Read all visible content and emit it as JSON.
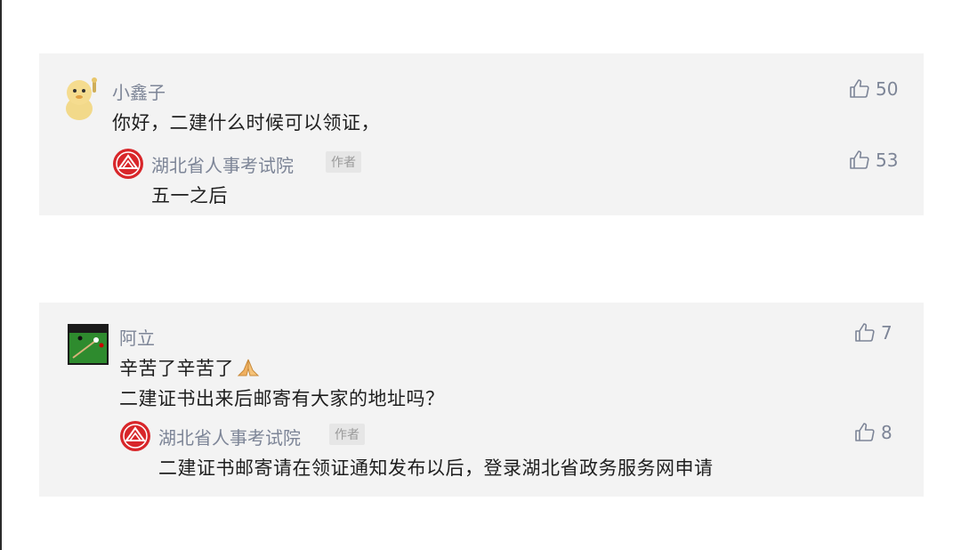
{
  "comments": [
    {
      "user": {
        "name": "小鑫子",
        "avatar": "yellow-chick-avatar"
      },
      "text_lines": [
        "你好，二建什么时候可以领证，"
      ],
      "likes": "50",
      "reply": {
        "user": {
          "name": "湖北省人事考试院",
          "avatar": "red-emblem-logo"
        },
        "badge": "作者",
        "text": "五一之后",
        "likes": "53"
      }
    },
    {
      "user": {
        "name": "阿立",
        "avatar": "snooker-table-avatar"
      },
      "text_lines": [
        "辛苦了辛苦了",
        "二建证书出来后邮寄有大家的地址吗？"
      ],
      "emoji": "praying-hands-emoji",
      "likes": "7",
      "reply": {
        "user": {
          "name": "湖北省人事考试院",
          "avatar": "red-emblem-logo"
        },
        "badge": "作者",
        "text": "二建证书邮寄请在领证通知发布以后，登录湖北省政务服务网申请",
        "likes": "8"
      }
    }
  ],
  "colors": {
    "card_bg": "#f3f3f3",
    "name_text": "#7d8597",
    "logo_red": "#d8262a"
  }
}
